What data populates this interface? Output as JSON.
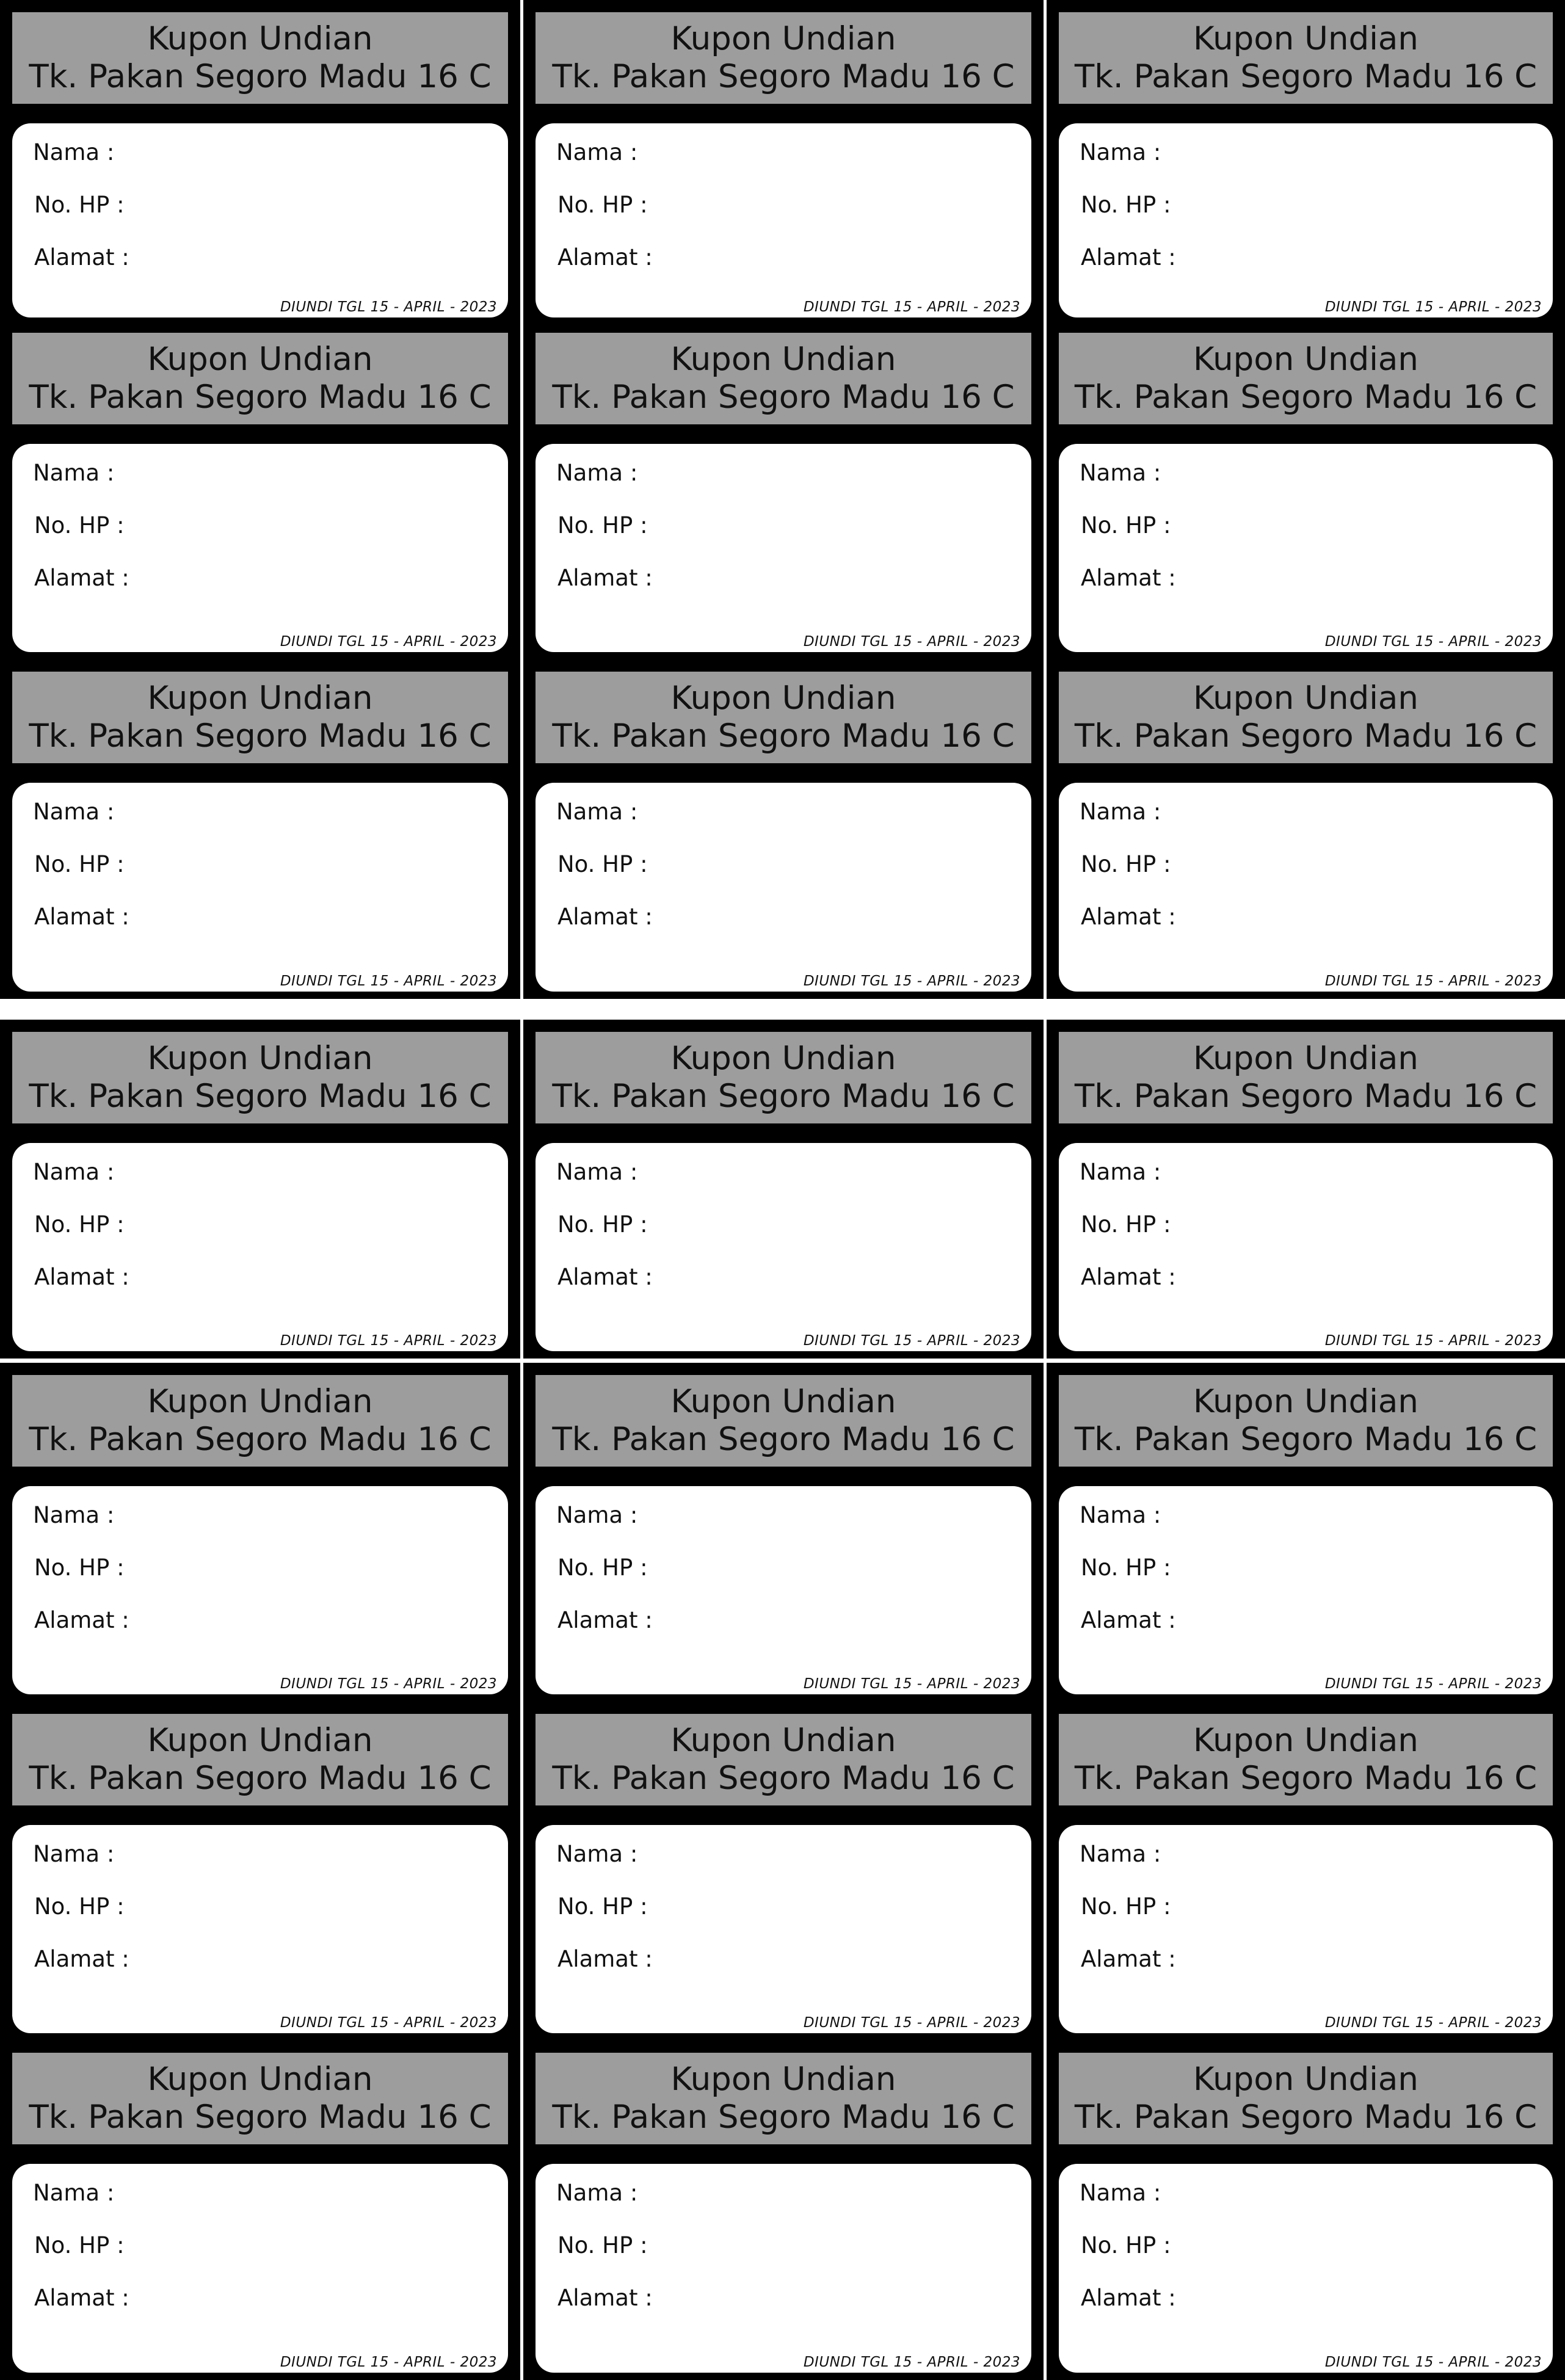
{
  "coupon": {
    "title_line1": "Kupon Undian",
    "title_line2": "Tk. Pakan Segoro Madu 16 C",
    "field_name": "Nama :",
    "field_phone": "No. HP :",
    "field_address": "Alamat :",
    "draw_date": "DIUNDI TGL 15 - APRIL - 2023"
  },
  "colors": {
    "header_background": "#9d9d9d",
    "coupon_border": "#000000",
    "body_background": "#ffffff"
  }
}
